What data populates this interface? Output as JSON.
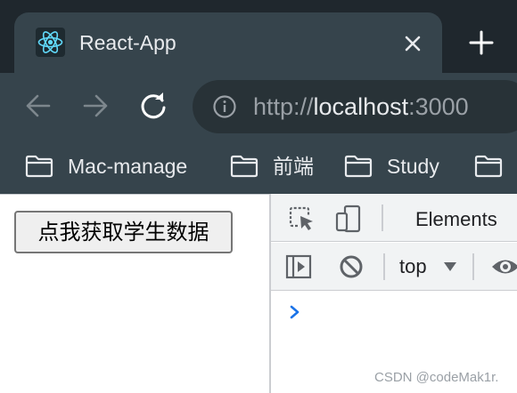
{
  "browser": {
    "tab": {
      "title": "React-App",
      "favicon": "react-icon",
      "close_icon": "close-icon"
    },
    "new_tab_icon": "plus-icon",
    "nav": {
      "back_icon": "back-arrow-icon",
      "forward_icon": "forward-arrow-icon",
      "reload_icon": "reload-icon"
    },
    "address_bar": {
      "info_icon": "info-icon",
      "url_scheme": "http://",
      "url_host": "localhost",
      "url_port": ":3000"
    },
    "bookmarks": [
      {
        "label": "Mac-manage",
        "icon": "folder-icon"
      },
      {
        "label": "前端",
        "icon": "folder-icon"
      },
      {
        "label": "Study",
        "icon": "folder-icon"
      }
    ]
  },
  "page": {
    "button_label": "点我获取学生数据"
  },
  "devtools": {
    "tabs": {
      "elements_label": "Elements"
    },
    "console": {
      "context_label": "top",
      "icons": [
        "inspect-icon",
        "device-toggle-icon",
        "sidebar-toggle-icon",
        "clear-console-icon",
        "eye-icon"
      ],
      "prompt_icon": "chevron-right-icon"
    }
  },
  "watermark": "CSDN @codeMak1r.",
  "colors": {
    "tabstrip_bg": "#1f272d",
    "chrome_bg": "#36444c",
    "omnibox_bg": "#283237",
    "text_light": "#e8eaed",
    "text_dim": "#9aa0a6",
    "devtools_bg": "#f1f3f4",
    "prompt_blue": "#1a73e8"
  }
}
